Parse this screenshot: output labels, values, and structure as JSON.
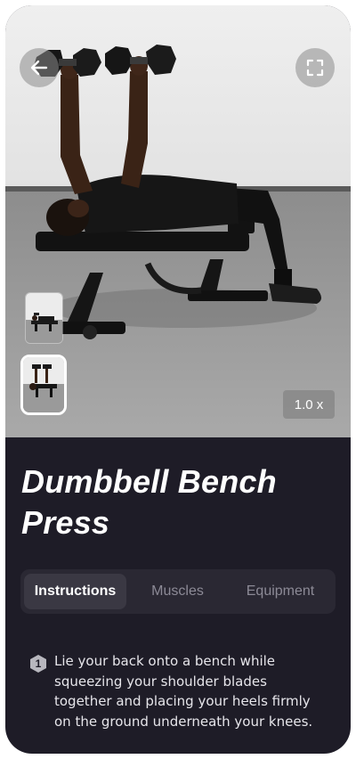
{
  "exercise": {
    "title": "Dumbbell Bench Press"
  },
  "player": {
    "speed_label": "1.0 x",
    "back_icon": "arrow-left-icon",
    "fullscreen_icon": "expand-icon"
  },
  "tabs": [
    {
      "label": "Instructions",
      "active": true
    },
    {
      "label": "Muscles",
      "active": false
    },
    {
      "label": "Equipment",
      "active": false
    }
  ],
  "steps": [
    {
      "number": "1",
      "text": "Lie your back onto a bench while squeezing your shoulder blades together and placing your heels firmly on the ground underneath your knees."
    }
  ],
  "colors": {
    "background": "#1e1c27",
    "tab_bar": "#2a2833",
    "tab_active": "#3a3843",
    "tab_inactive_text": "#8c8a96",
    "text": "#ffffff"
  }
}
